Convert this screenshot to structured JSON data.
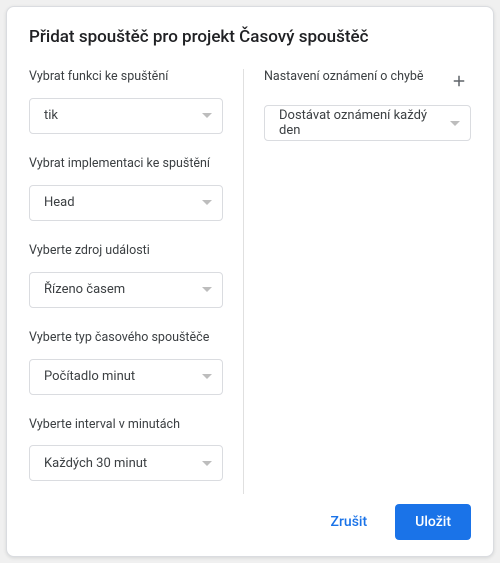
{
  "dialog": {
    "title": "Přidat spouštěč pro projekt Časový spouštěč"
  },
  "left": {
    "function": {
      "label": "Vybrat funkci ke spuštění",
      "value": "tik"
    },
    "deployment": {
      "label": "Vybrat implementaci ke spuštění",
      "value": "Head"
    },
    "eventSource": {
      "label": "Vyberte zdroj události",
      "value": "Řízeno časem"
    },
    "triggerType": {
      "label": "Vyberte typ časového spouštěče",
      "value": "Počítadlo minut"
    },
    "interval": {
      "label": "Vyberte interval v minutách",
      "value": "Každých 30 minut"
    }
  },
  "right": {
    "notifications": {
      "label": "Nastavení oznámení o chybě",
      "value": "Dostávat oznámení každý den"
    }
  },
  "footer": {
    "cancel": "Zrušit",
    "save": "Uložit"
  }
}
